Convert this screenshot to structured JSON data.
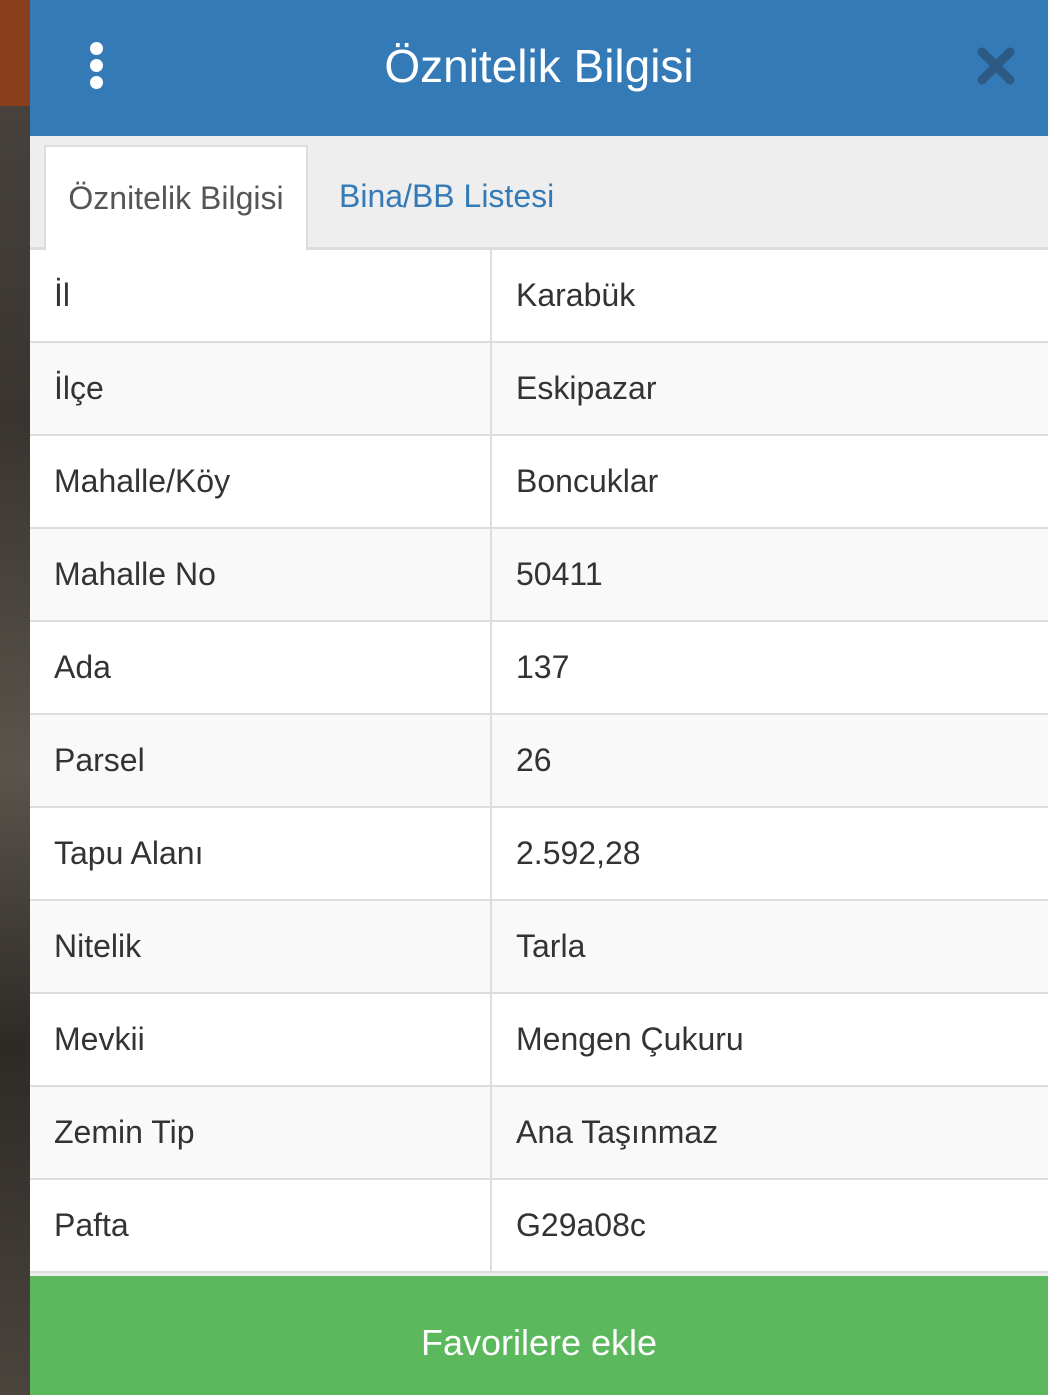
{
  "header": {
    "title": "Öznitelik Bilgisi"
  },
  "tabs": [
    {
      "label": "Öznitelik Bilgisi",
      "active": true
    },
    {
      "label": "Bina/BB Listesi",
      "active": false
    }
  ],
  "table": {
    "rows": [
      {
        "key": "İl",
        "value": "Karabük"
      },
      {
        "key": "İlçe",
        "value": "Eskipazar"
      },
      {
        "key": "Mahalle/Köy",
        "value": "Boncuklar"
      },
      {
        "key": "Mahalle No",
        "value": "50411"
      },
      {
        "key": "Ada",
        "value": "137"
      },
      {
        "key": "Parsel",
        "value": "26"
      },
      {
        "key": "Tapu Alanı",
        "value": "2.592,28"
      },
      {
        "key": "Nitelik",
        "value": "Tarla"
      },
      {
        "key": "Mevkii",
        "value": "Mengen Çukuru"
      },
      {
        "key": "Zemin Tip",
        "value": "Ana Taşınmaz"
      },
      {
        "key": "Pafta",
        "value": "G29a08c"
      }
    ]
  },
  "footer": {
    "button_label": "Favorilere ekle"
  },
  "colors": {
    "header_bg": "#337ab7",
    "button_bg": "#5cb85c",
    "close_icon": "#2c5a84"
  },
  "icons": {
    "menu": "vertical-dots-icon",
    "close": "close-icon"
  }
}
